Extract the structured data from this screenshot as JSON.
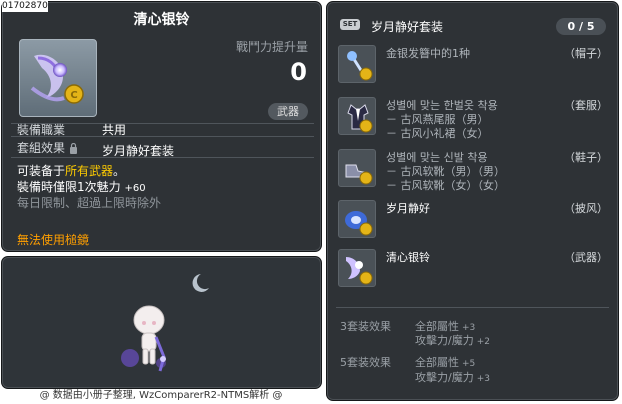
{
  "item_id": "01702870",
  "item": {
    "name": "清心银铃",
    "attack_increase_label": "戰鬥力提升量",
    "attack_increase_value": "0",
    "category_tag": "武器",
    "job_label": "裝備職業",
    "job_value": "共用",
    "set_effect_label": "套組效果",
    "set_effect_value": "岁月静好套装",
    "desc_prefix": "可装备于",
    "desc_highlight": "所有武器",
    "desc_suffix": "。",
    "limit_text": "裝備時僅限1次魅力",
    "limit_bonus": "+60",
    "limit_note": "每日限制、超過上限時除外",
    "warning": "無法使用槌鏡"
  },
  "footer": "@ 数据由小册子整理, WzComparerR2-NTMS解析 @",
  "set": {
    "badge": "SET",
    "title": "岁月静好套装",
    "count": "0 / 5",
    "items": [
      {
        "name": "金银发簪中的1种",
        "slot": "（帽子）",
        "subs": [],
        "icon": "hairpin-icon"
      },
      {
        "name": "성별에 맞는 한벌옷 착용",
        "slot": "（套服）",
        "subs": [
          "－ 古风燕尾服（男）",
          "－ 古风小礼裙（女）"
        ],
        "icon": "suit-icon"
      },
      {
        "name": "성별에 맞는 신발 착용",
        "slot": "（鞋子）",
        "subs": [
          "－ 古风软靴（男）（男）",
          "－ 古风软靴（女）（女）"
        ],
        "icon": "shoes-icon"
      },
      {
        "name": "岁月静好",
        "slot": "（披风）",
        "subs": [],
        "icon": "cape-icon"
      },
      {
        "name": "清心银铃",
        "slot": "（武器）",
        "subs": [],
        "icon": "bell-icon"
      }
    ],
    "bonuses": [
      {
        "label": "3套装效果",
        "lines": [
          {
            "text": "全部屬性",
            "value": "+3"
          },
          {
            "text": "攻擊力/魔力",
            "value": "+2"
          }
        ]
      },
      {
        "label": "5套装效果",
        "lines": [
          {
            "text": "全部屬性",
            "value": "+5"
          },
          {
            "text": "攻擊力/魔力",
            "value": "+3"
          }
        ]
      }
    ]
  }
}
